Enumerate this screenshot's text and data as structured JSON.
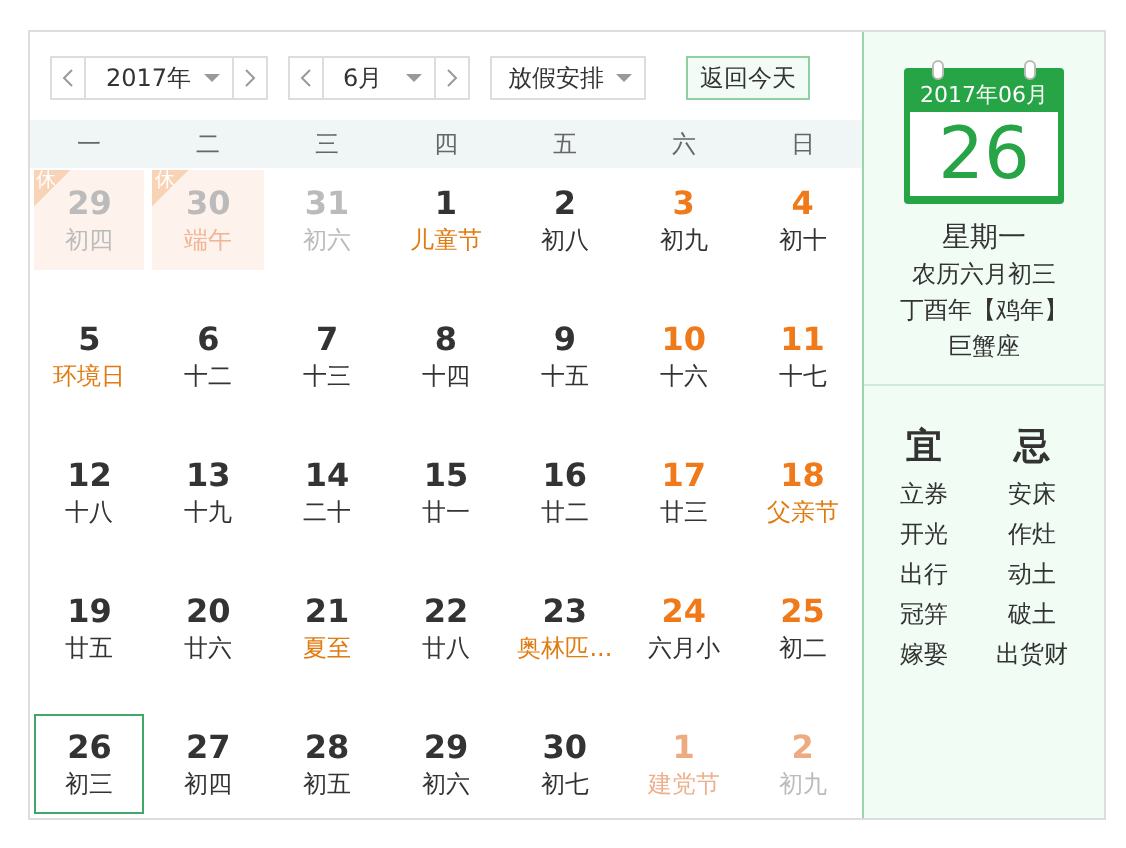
{
  "toolbar": {
    "year": "2017年",
    "month": "6月",
    "holiday_menu": "放假安排",
    "today_button": "返回今天"
  },
  "weekdays": [
    "一",
    "二",
    "三",
    "四",
    "五",
    "六",
    "日"
  ],
  "weeks": [
    [
      {
        "day": "29",
        "lunar": "初四",
        "outside": true,
        "weekend": false,
        "festival": false,
        "rest": "休",
        "selected": false
      },
      {
        "day": "30",
        "lunar": "端午",
        "outside": true,
        "weekend": false,
        "festival": true,
        "rest": "休",
        "selected": false
      },
      {
        "day": "31",
        "lunar": "初六",
        "outside": true,
        "weekend": false,
        "festival": false,
        "selected": false
      },
      {
        "day": "1",
        "lunar": "儿童节",
        "outside": false,
        "weekend": false,
        "festival": true,
        "selected": false
      },
      {
        "day": "2",
        "lunar": "初八",
        "outside": false,
        "weekend": false,
        "festival": false,
        "selected": false
      },
      {
        "day": "3",
        "lunar": "初九",
        "outside": false,
        "weekend": true,
        "festival": false,
        "selected": false
      },
      {
        "day": "4",
        "lunar": "初十",
        "outside": false,
        "weekend": true,
        "festival": false,
        "selected": false
      }
    ],
    [
      {
        "day": "5",
        "lunar": "环境日",
        "outside": false,
        "weekend": false,
        "festival": true,
        "selected": false
      },
      {
        "day": "6",
        "lunar": "十二",
        "outside": false,
        "weekend": false,
        "festival": false,
        "selected": false
      },
      {
        "day": "7",
        "lunar": "十三",
        "outside": false,
        "weekend": false,
        "festival": false,
        "selected": false
      },
      {
        "day": "8",
        "lunar": "十四",
        "outside": false,
        "weekend": false,
        "festival": false,
        "selected": false
      },
      {
        "day": "9",
        "lunar": "十五",
        "outside": false,
        "weekend": false,
        "festival": false,
        "selected": false
      },
      {
        "day": "10",
        "lunar": "十六",
        "outside": false,
        "weekend": true,
        "festival": false,
        "selected": false
      },
      {
        "day": "11",
        "lunar": "十七",
        "outside": false,
        "weekend": true,
        "festival": false,
        "selected": false
      }
    ],
    [
      {
        "day": "12",
        "lunar": "十八",
        "outside": false,
        "weekend": false,
        "festival": false,
        "selected": false
      },
      {
        "day": "13",
        "lunar": "十九",
        "outside": false,
        "weekend": false,
        "festival": false,
        "selected": false
      },
      {
        "day": "14",
        "lunar": "二十",
        "outside": false,
        "weekend": false,
        "festival": false,
        "selected": false
      },
      {
        "day": "15",
        "lunar": "廿一",
        "outside": false,
        "weekend": false,
        "festival": false,
        "selected": false
      },
      {
        "day": "16",
        "lunar": "廿二",
        "outside": false,
        "weekend": false,
        "festival": false,
        "selected": false
      },
      {
        "day": "17",
        "lunar": "廿三",
        "outside": false,
        "weekend": true,
        "festival": false,
        "selected": false
      },
      {
        "day": "18",
        "lunar": "父亲节",
        "outside": false,
        "weekend": true,
        "festival": true,
        "selected": false
      }
    ],
    [
      {
        "day": "19",
        "lunar": "廿五",
        "outside": false,
        "weekend": false,
        "festival": false,
        "selected": false
      },
      {
        "day": "20",
        "lunar": "廿六",
        "outside": false,
        "weekend": false,
        "festival": false,
        "selected": false
      },
      {
        "day": "21",
        "lunar": "夏至",
        "outside": false,
        "weekend": false,
        "festival": true,
        "selected": false
      },
      {
        "day": "22",
        "lunar": "廿八",
        "outside": false,
        "weekend": false,
        "festival": false,
        "selected": false
      },
      {
        "day": "23",
        "lunar": "奥林匹...",
        "outside": false,
        "weekend": false,
        "festival": true,
        "selected": false
      },
      {
        "day": "24",
        "lunar": "六月小",
        "outside": false,
        "weekend": true,
        "festival": false,
        "selected": false
      },
      {
        "day": "25",
        "lunar": "初二",
        "outside": false,
        "weekend": true,
        "festival": false,
        "selected": false
      }
    ],
    [
      {
        "day": "26",
        "lunar": "初三",
        "outside": false,
        "weekend": false,
        "festival": false,
        "selected": true
      },
      {
        "day": "27",
        "lunar": "初四",
        "outside": false,
        "weekend": false,
        "festival": false,
        "selected": false
      },
      {
        "day": "28",
        "lunar": "初五",
        "outside": false,
        "weekend": false,
        "festival": false,
        "selected": false
      },
      {
        "day": "29",
        "lunar": "初六",
        "outside": false,
        "weekend": false,
        "festival": false,
        "selected": false
      },
      {
        "day": "30",
        "lunar": "初七",
        "outside": false,
        "weekend": false,
        "festival": false,
        "selected": false
      },
      {
        "day": "1",
        "lunar": "建党节",
        "outside": true,
        "weekend": true,
        "festival": true,
        "selected": false
      },
      {
        "day": "2",
        "lunar": "初九",
        "outside": true,
        "weekend": true,
        "festival": false,
        "selected": false
      }
    ]
  ],
  "detail": {
    "month": "2017年06月",
    "day": "26",
    "weekday": "星期一",
    "lunar": "农历六月初三",
    "year": "丁酉年【鸡年】",
    "zodiac": "巨蟹座"
  },
  "almanac": {
    "good_title": "宜",
    "good": [
      "立券",
      "开光",
      "出行",
      "冠笄",
      "嫁娶"
    ],
    "bad_title": "忌",
    "bad": [
      "安床",
      "作灶",
      "动土",
      "破土",
      "出货财"
    ]
  }
}
